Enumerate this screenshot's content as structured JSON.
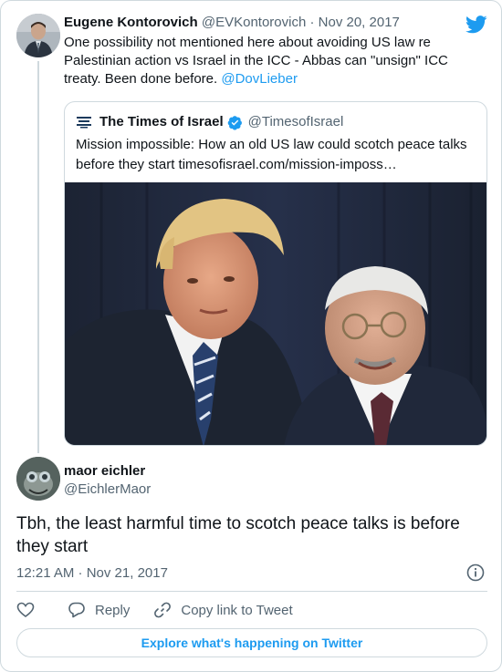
{
  "parent_tweet": {
    "author_name": "Eugene Kontorovich",
    "author_handle": "@EVKontorovich",
    "separator": " · ",
    "date": "Nov 20, 2017",
    "text_before_mention": "One possibility not mentioned here about avoiding US law re Palestinian action vs Israel in the ICC - Abbas can \"unsign\" ICC treaty. Been done before. ",
    "mention": "@DovLieber"
  },
  "quoted_tweet": {
    "logo_text": "THE TIMES OF ISRAEL",
    "author_name": "The Times of Israel",
    "author_handle": "@TimesofIsrael",
    "text": "Mission impossible: How an old US law could scotch peace talks before they start timesofisrael.com/mission-imposs…"
  },
  "reply_tweet": {
    "author_name": "maor eichler",
    "author_handle": "@EichlerMaor",
    "text": "Tbh, the least harmful time to scotch peace talks is before they start",
    "timestamp": "12:21 AM · Nov 21, 2017"
  },
  "actions": {
    "like_icon": "heart-icon",
    "reply_label": "Reply",
    "copy_link_label": "Copy link to Tweet"
  },
  "explore_label": "Explore what's happening on Twitter",
  "colors": {
    "accent": "#1d9bf0",
    "text": "#0f1419",
    "muted": "#536471",
    "border": "#cfd9de"
  }
}
